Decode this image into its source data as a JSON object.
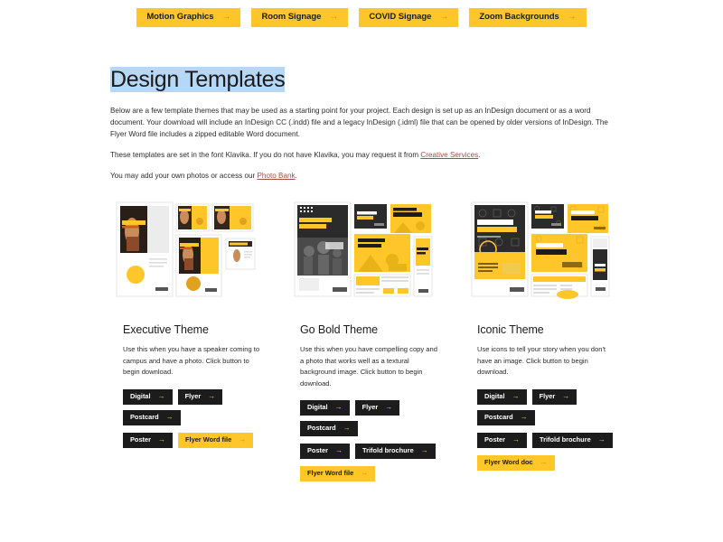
{
  "topnav": {
    "items": [
      {
        "label": "Motion Graphics",
        "icon": "arrow-right-icon"
      },
      {
        "label": "Room Signage",
        "icon": "arrow-right-icon"
      },
      {
        "label": "COVID Signage",
        "icon": "arrow-right-icon"
      },
      {
        "label": "Zoom Backgrounds",
        "icon": "arrow-right-icon"
      }
    ]
  },
  "header": {
    "title": "Design Templates",
    "paragraph1": "Below are a few template themes that may be used as a starting point for your project. Each design is set up as an InDesign document or as a word document. Your download will include an InDesign CC (.indd) file and a legacy InDesign (.idml) file that can be opened by older versions of InDesign. The Flyer Word file includes a zipped editable Word document.",
    "paragraph2_before": "These templates are set in the font Klavika. If you do not have Klavika, you may request it from ",
    "paragraph2_link": "Creative Services",
    "paragraph2_after": ".",
    "paragraph3_before": "You may add your own photos or access our ",
    "paragraph3_link": "Photo Bank",
    "paragraph3_after": "."
  },
  "themes": [
    {
      "id": "executive",
      "title": "Executive Theme",
      "description": "Use this when you have a speaker coming to campus and have a photo. Click button to begin download.",
      "preview_headline": "KEYNOTE SPEAKER",
      "button_rows": [
        [
          {
            "label": "Digital",
            "style": "dark"
          },
          {
            "label": "Flyer",
            "style": "dark"
          },
          {
            "label": "Postcard",
            "style": "dark"
          }
        ],
        [
          {
            "label": "Poster",
            "style": "dark"
          },
          {
            "label": "Flyer Word file",
            "style": "yellow"
          }
        ]
      ]
    },
    {
      "id": "go-bold",
      "title": "Go Bold Theme",
      "description": "Use this when you have compelling copy and a photo that works well as a textural background image. Click button to begin download.",
      "preview_headline": "HEADLINE GOES HERE",
      "button_rows": [
        [
          {
            "label": "Digital",
            "style": "dark"
          },
          {
            "label": "Flyer",
            "style": "dark"
          },
          {
            "label": "Postcard",
            "style": "dark"
          }
        ],
        [
          {
            "label": "Poster",
            "style": "dark"
          },
          {
            "label": "Trifold brochure",
            "style": "dark"
          }
        ],
        [
          {
            "label": "Flyer Word file",
            "style": "yellow"
          }
        ]
      ]
    },
    {
      "id": "iconic",
      "title": "Iconic Theme",
      "description": "Use icons to tell your story when you don't have an image. Click button to begin download.",
      "preview_headline": "HEADLINE GOES HERE",
      "button_rows": [
        [
          {
            "label": "Digital",
            "style": "dark"
          },
          {
            "label": "Flyer",
            "style": "dark"
          },
          {
            "label": "Postcard",
            "style": "dark"
          }
        ],
        [
          {
            "label": "Poster",
            "style": "dark"
          },
          {
            "label": "Trifold brochure",
            "style": "dark"
          }
        ],
        [
          {
            "label": "Flyer Word doc",
            "style": "yellow"
          }
        ]
      ]
    }
  ],
  "colors": {
    "accent_yellow": "#FFC629",
    "arrow_orange": "#E08A00",
    "dark_button": "#1C1C1C",
    "link": "#A54A4A",
    "selection_highlight": "#B7D7F7"
  },
  "icons": {
    "arrow_right": "→"
  }
}
